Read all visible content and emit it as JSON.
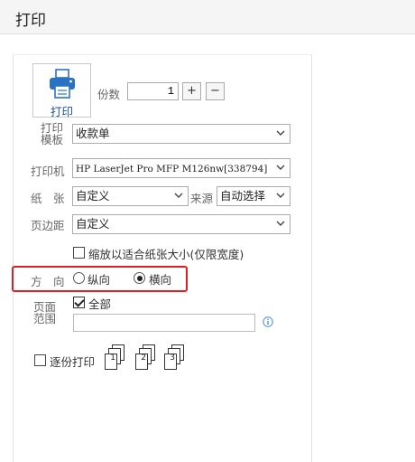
{
  "window": {
    "title": "打印"
  },
  "print_button": {
    "label": "打印",
    "icon": "printer-icon"
  },
  "copies": {
    "label": "份数",
    "value": "1",
    "plus": "+",
    "minus": "−"
  },
  "template": {
    "label_line1": "打印",
    "label_line2": "模板",
    "value": "收款单"
  },
  "printer": {
    "label": "打印机",
    "value": "HP LaserJet Pro MFP M126nw[338794]"
  },
  "paper": {
    "label": "纸　张",
    "value": "自定义",
    "source_label": "来源",
    "source_value": "自动选择"
  },
  "margin": {
    "label": "页边距",
    "value": "自定义"
  },
  "scale_fit": {
    "label": "缩放以适合纸张大小(仅限宽度)",
    "checked": false
  },
  "orientation": {
    "label": "方　向",
    "portrait": "纵向",
    "landscape": "横向",
    "selected": "landscape"
  },
  "page_range": {
    "label_line1": "页面",
    "label_line2": "范围",
    "all_label": "全部",
    "all_checked": true,
    "input_value": ""
  },
  "collate": {
    "label": "逐份打印",
    "checked": false,
    "pages": [
      "1",
      "2",
      "3"
    ]
  },
  "colors": {
    "highlight": "#e02020",
    "accent_text": "#1b4f9c"
  }
}
